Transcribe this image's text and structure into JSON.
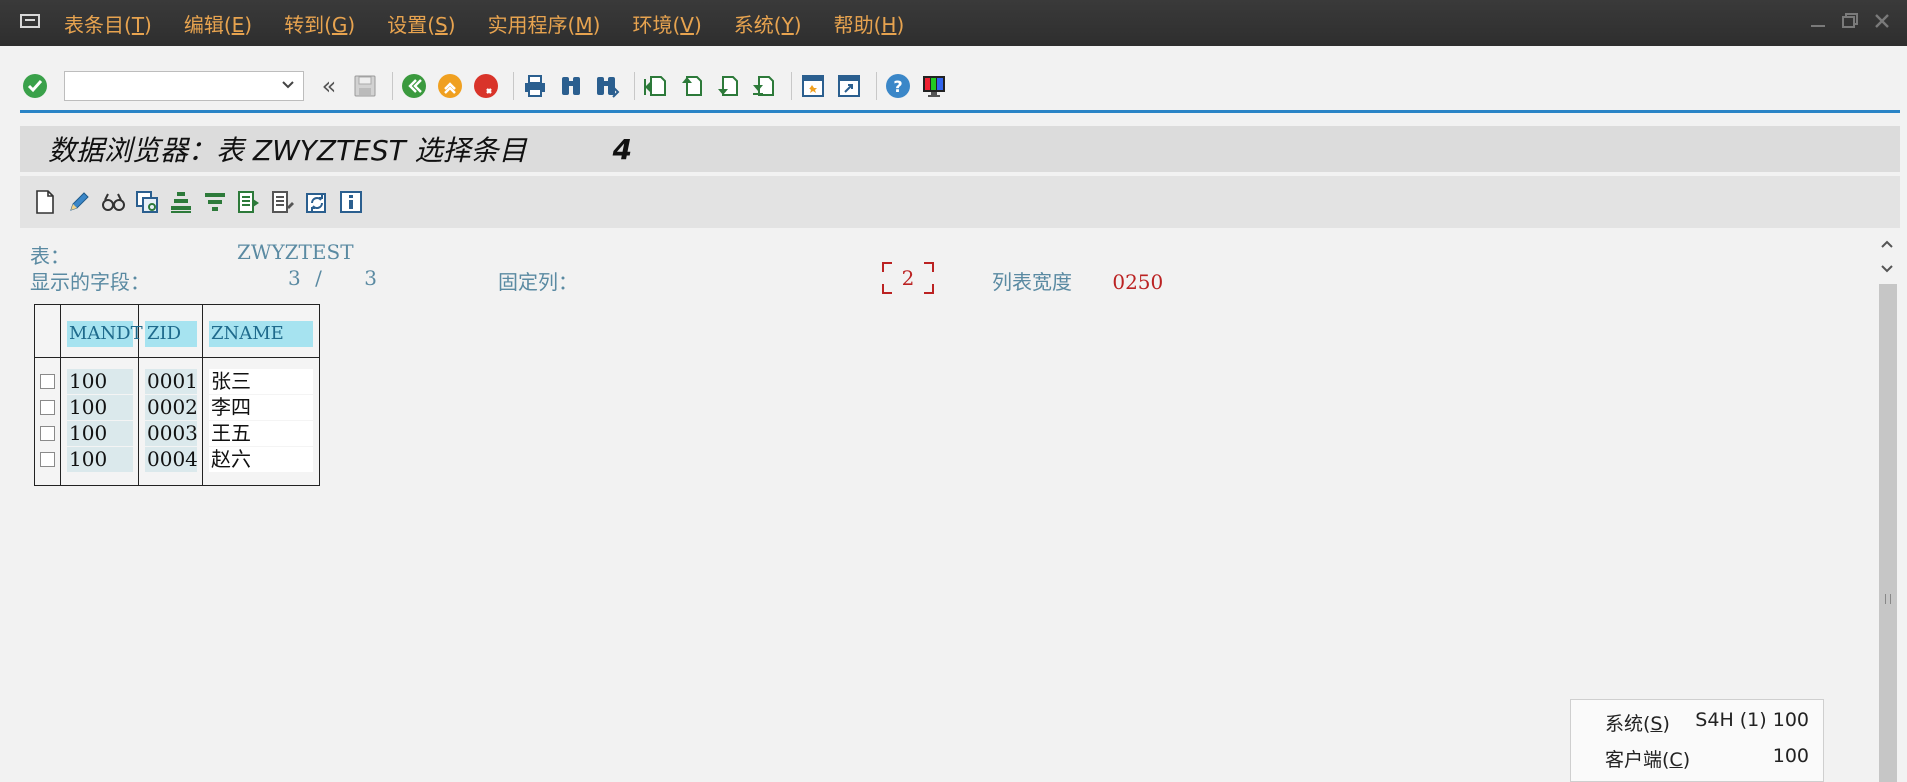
{
  "menubar": {
    "items": [
      {
        "label": "表条目(",
        "key": "T"
      },
      {
        "label": "编辑(",
        "key": "E"
      },
      {
        "label": "转到(",
        "key": "G"
      },
      {
        "label": "设置(",
        "key": "S"
      },
      {
        "label": "实用程序(",
        "key": "M"
      },
      {
        "label": "环境(",
        "key": "V"
      },
      {
        "label": "系统(",
        "key": "Y"
      },
      {
        "label": "帮助(",
        "key": "H"
      }
    ],
    "close_paren": ")"
  },
  "toolbar": {
    "command_field_value": "",
    "back_glyph": "«",
    "icons": [
      "enter-check-icon",
      "save-icon",
      "back-icon",
      "exit-icon",
      "cancel-icon",
      "print-icon",
      "find-icon",
      "find-next-icon",
      "first-page-icon",
      "previous-page-icon",
      "next-page-icon",
      "last-page-icon",
      "create-session-icon",
      "shortcut-icon",
      "help-icon",
      "layout-icon"
    ]
  },
  "title": {
    "text": "数据浏览器：表 ZWYZTEST 选择条目",
    "count": "4"
  },
  "app_toolbar": {
    "icons": [
      "create-icon",
      "edit-icon",
      "display-icon",
      "copy-icon",
      "sort-ascending-icon",
      "filter-icon",
      "select-layout-icon",
      "change-layout-icon",
      "refresh-icon",
      "info-icon"
    ]
  },
  "header_fields": {
    "table_label": "表：",
    "table_value": "ZWYZTEST",
    "fields_label": "显示的字段：",
    "fields_shown": "3",
    "fields_sep": "/",
    "fields_total": "3",
    "fixed_label": "固定列：",
    "fixed_value": "2",
    "width_label": "列表宽度",
    "width_value": "0250"
  },
  "table": {
    "columns": [
      "MANDT",
      "ZID",
      "ZNAME"
    ],
    "rows": [
      {
        "mandt": "100",
        "zid": "0001",
        "zname": "张三"
      },
      {
        "mandt": "100",
        "zid": "0002",
        "zname": "李四"
      },
      {
        "mandt": "100",
        "zid": "0003",
        "zname": "王五"
      },
      {
        "mandt": "100",
        "zid": "0004",
        "zname": "赵六"
      }
    ]
  },
  "status_popup": {
    "system_label": "系统(",
    "system_key": "S",
    "system_value": "S4H (1) 100",
    "client_label": "客户端(",
    "client_key": "C",
    "client_value": "100",
    "close_paren": ")"
  },
  "colors": {
    "menu_text": "#e7a34f",
    "accent_blue": "#2a84c6",
    "field_label": "#5a8aa2",
    "red_value": "#bb2222",
    "header_cell": "#a6e3f0"
  }
}
